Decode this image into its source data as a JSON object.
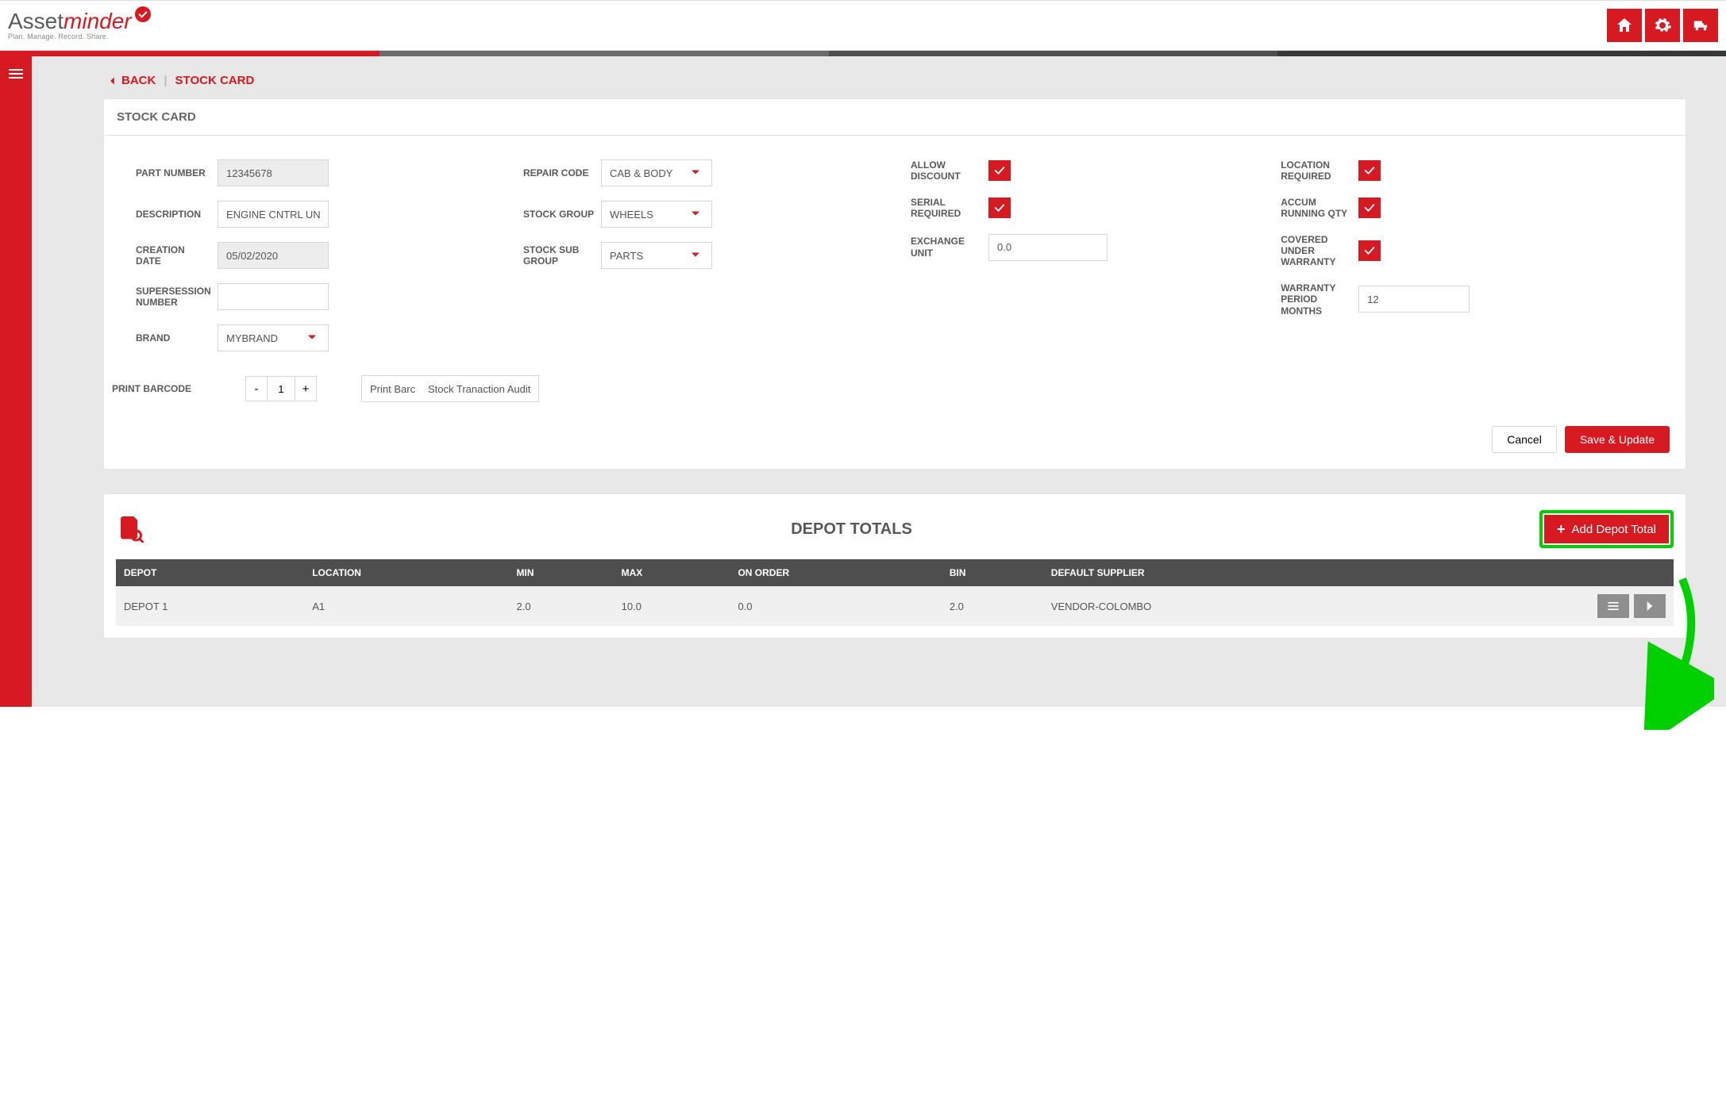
{
  "header": {
    "logo_text1": "Asset",
    "logo_text2": "minder",
    "tagline": "Plan. Manage. Record. Share.",
    "icons": [
      "home-icon",
      "gear-icon",
      "truck-icon"
    ]
  },
  "crumb": {
    "back": "BACK",
    "sep": "|",
    "title": "STOCK CARD"
  },
  "card": {
    "title": "STOCK CARD",
    "fields": {
      "part_number_label": "PART NUMBER",
      "part_number": "12345678",
      "description_label": "DESCRIPTION",
      "description": "ENGINE CNTRL UN",
      "creation_date_label": "CREATION DATE",
      "creation_date": "05/02/2020",
      "supersession_label": "SUPERSESSION NUMBER",
      "supersession": "",
      "brand_label": "BRAND",
      "brand": "MYBRAND",
      "repair_code_label": "REPAIR CODE",
      "repair_code": "CAB & BODY",
      "stock_group_label": "STOCK GROUP",
      "stock_group": "WHEELS",
      "stock_sub_group_label": "STOCK SUB GROUP",
      "stock_sub_group": "PARTS",
      "allow_discount_label": "ALLOW DISCOUNT",
      "serial_required_label": "SERIAL REQUIRED",
      "exchange_unit_label": "EXCHANGE UNIT",
      "exchange_unit": "0.0",
      "location_required_label": "LOCATION REQUIRED",
      "accum_running_qty_label": "ACCUM RUNNING QTY",
      "covered_warranty_label": "COVERED UNDER WARRANTY",
      "warranty_months_label": "WARRANTY PERIOD MONTHS",
      "warranty_months": "12"
    },
    "print_barcode_label": "PRINT BARCODE",
    "print_barcode_qty": "1",
    "btn_print_barcode": "Print Barc",
    "btn_stock_audit": "Stock Tranaction Audit",
    "btn_cancel": "Cancel",
    "btn_save": "Save & Update"
  },
  "depot": {
    "title": "DEPOT TOTALS",
    "add_btn": "Add Depot Total",
    "columns": [
      "DEPOT",
      "LOCATION",
      "MIN",
      "MAX",
      "ON ORDER",
      "BIN",
      "DEFAULT SUPPLIER"
    ],
    "rows": [
      {
        "depot": "DEPOT 1",
        "location": "A1",
        "min": "2.0",
        "max": "10.0",
        "on_order": "0.0",
        "bin": "2.0",
        "supplier": "VENDOR-COLOMBO"
      }
    ]
  }
}
